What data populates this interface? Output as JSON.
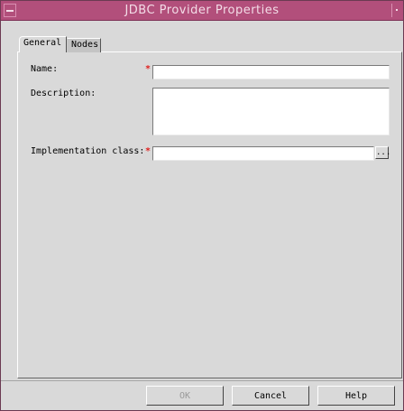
{
  "window": {
    "title": "JDBC Provider Properties"
  },
  "tabs": [
    {
      "label": "General",
      "selected": true
    },
    {
      "label": "Nodes",
      "selected": false
    }
  ],
  "form": {
    "name": {
      "label": "Name:",
      "required_marker": "*",
      "value": ""
    },
    "description": {
      "label": "Description:",
      "value": ""
    },
    "implementation_class": {
      "label": "Implementation class:",
      "required_marker": "*",
      "value": "",
      "browse_label": "..."
    }
  },
  "buttons": {
    "ok": {
      "label": "OK",
      "enabled": false
    },
    "cancel": {
      "label": "Cancel"
    },
    "help": {
      "label": "Help"
    }
  },
  "colors": {
    "titlebar": "#b24f7b",
    "title_text": "#f3dce7",
    "required_marker": "#e0201e",
    "window_background": "#d9d9d9"
  }
}
